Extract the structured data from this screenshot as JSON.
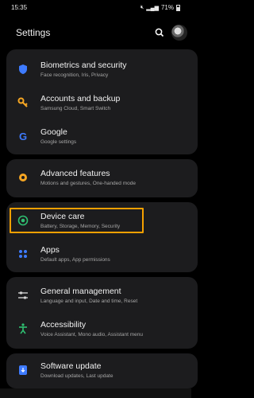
{
  "status_bar": {
    "time": "15:35",
    "battery": "71%",
    "icons": [
      "mute-icon",
      "signal-icon",
      "battery-icon"
    ]
  },
  "header": {
    "title": "Settings",
    "search_icon": "search-icon",
    "avatar": "profile-avatar"
  },
  "groups": [
    {
      "items": [
        {
          "title": "Biometrics and security",
          "subtitle": "Face recognition, Iris, Privacy",
          "icon": "shield-icon",
          "color": "#3e7bff"
        },
        {
          "title": "Accounts and backup",
          "subtitle": "Samsung Cloud, Smart Switch",
          "icon": "key-icon",
          "color": "#f6a623"
        },
        {
          "title": "Google",
          "subtitle": "Google settings",
          "icon": "google-icon",
          "color": "#3e7bff"
        }
      ]
    },
    {
      "items": [
        {
          "title": "Advanced features",
          "subtitle": "Motions and gestures, One-handed mode",
          "icon": "gear-plus-icon",
          "color": "#f6a623"
        }
      ]
    },
    {
      "items": [
        {
          "title": "Device care",
          "subtitle": "Battery, Storage, Memory, Security",
          "icon": "device-care-icon",
          "color": "#2fbf71"
        },
        {
          "title": "Apps",
          "subtitle": "Default apps, App permissions",
          "icon": "apps-grid-icon",
          "color": "#3e7bff"
        }
      ]
    },
    {
      "items": [
        {
          "title": "General management",
          "subtitle": "Language and input, Date and time, Reset",
          "icon": "sliders-icon",
          "color": "#d0d0d0"
        },
        {
          "title": "Accessibility",
          "subtitle": "Voice Assistant, Mono audio, Assistant menu",
          "icon": "accessibility-icon",
          "color": "#2fbf71"
        }
      ]
    },
    {
      "items": [
        {
          "title": "Software update",
          "subtitle": "Download updates, Last update",
          "icon": "software-update-icon",
          "color": "#3e7bff"
        }
      ]
    }
  ],
  "highlight_color": "#f5a000"
}
